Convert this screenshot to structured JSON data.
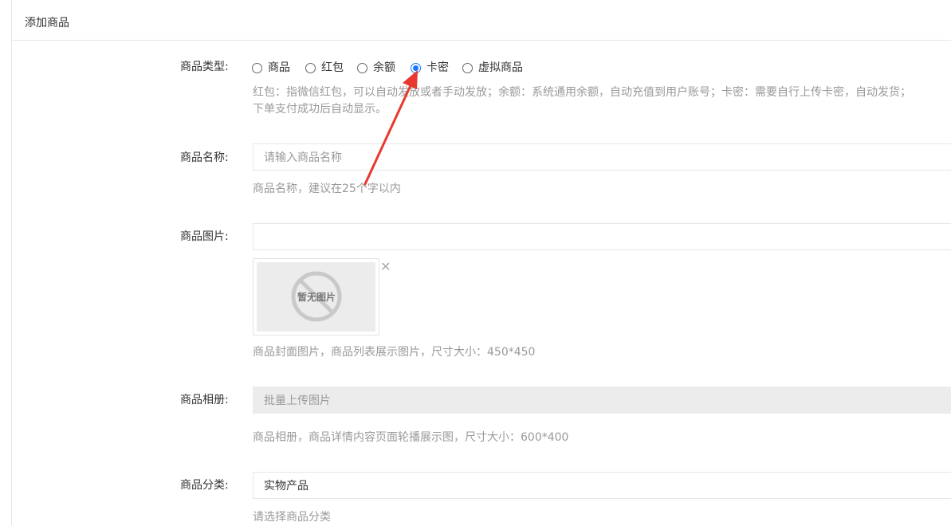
{
  "panel": {
    "title": "添加商品"
  },
  "product_type": {
    "label": "商品类型:",
    "options": [
      {
        "label": "商品",
        "checked": false
      },
      {
        "label": "红包",
        "checked": false
      },
      {
        "label": "余额",
        "checked": false
      },
      {
        "label": "卡密",
        "checked": true
      },
      {
        "label": "虚拟商品",
        "checked": false
      }
    ],
    "help_line1": "红包：指微信红包，可以自动发放或者手动发放；余额：系统通用余额，自动充值到用户账号；卡密：需要自行上传卡密，自动发货；",
    "help_line2": "下单支付成功后自动显示。"
  },
  "product_name": {
    "label": "商品名称:",
    "placeholder": "请输入商品名称",
    "help": "商品名称，建议在25个字以内"
  },
  "product_image": {
    "label": "商品图片:",
    "value": "",
    "thumb_text": "暂无图片",
    "remove_icon": "close-icon",
    "help": "商品封面图片，商品列表展示图片，尺寸大小：450*450"
  },
  "product_album": {
    "label": "商品相册:",
    "button_text": "批量上传图片",
    "help": "商品相册，商品详情内容页面轮播展示图，尺寸大小：600*400"
  },
  "product_category": {
    "label": "商品分类:",
    "value": "实物产品",
    "help": "请选择商品分类"
  },
  "colors": {
    "accent": "#1677ff",
    "arrow": "#e8382f",
    "help_text": "#999999",
    "border": "#e6e6e6"
  }
}
